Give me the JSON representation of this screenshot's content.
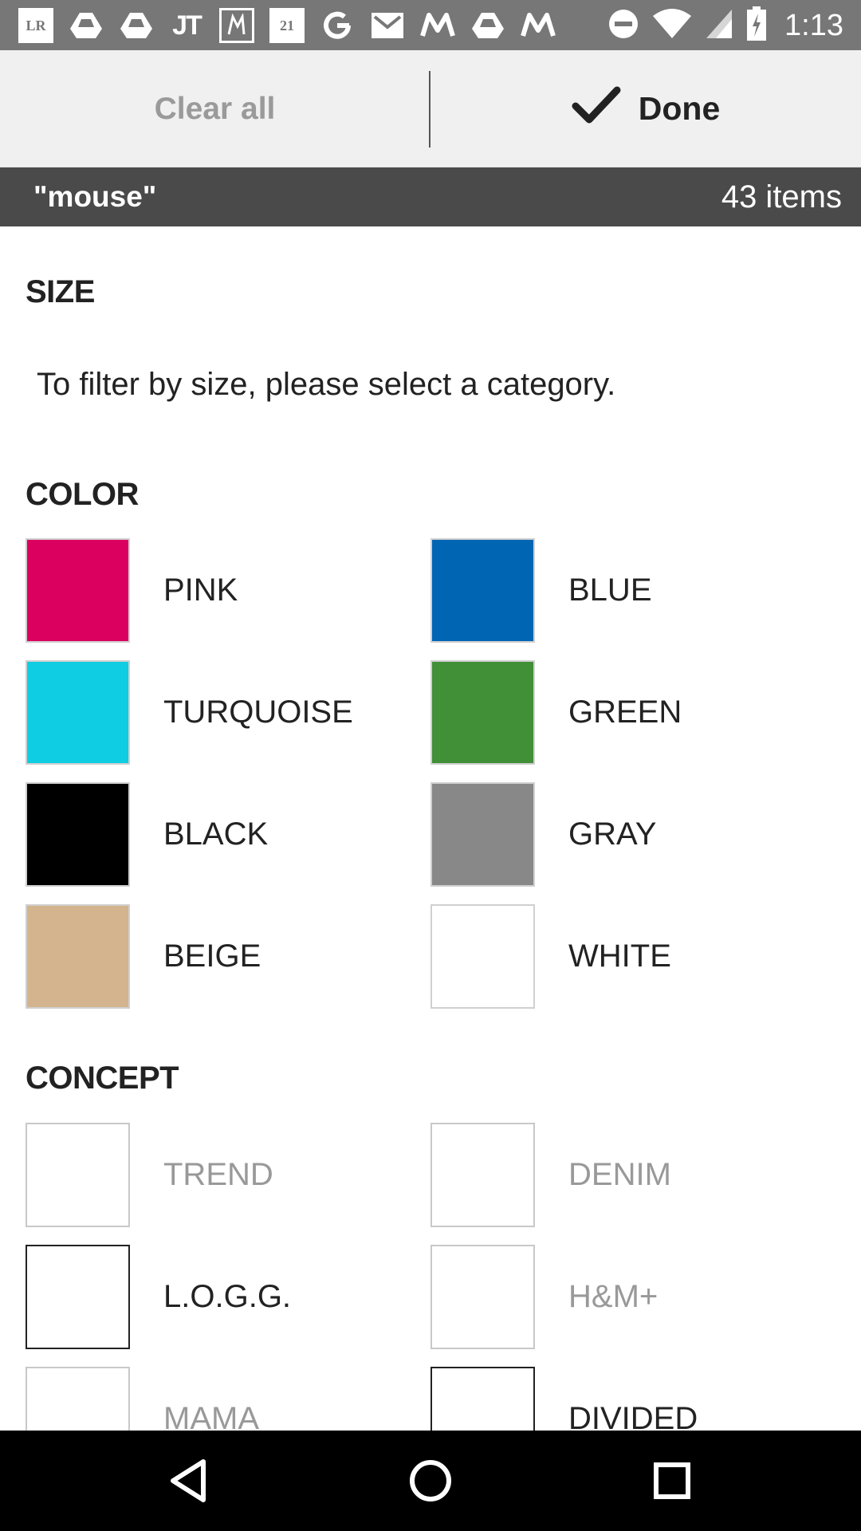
{
  "status_bar": {
    "time": "1:13",
    "left_icons": [
      "lr-icon",
      "drive-icon",
      "drive-icon",
      "jt-icon",
      "nt-icon",
      "forever21-icon",
      "google-icon",
      "gmail-icon",
      "m-icon",
      "drive-icon",
      "m-icon"
    ],
    "lr_text": "LR",
    "jt_text": "JT",
    "f21_text": "21",
    "right_icons": [
      "do-not-disturb-icon",
      "wifi-icon",
      "signal-icon",
      "battery-icon"
    ]
  },
  "action_bar": {
    "clear_label": "Clear all",
    "done_label": "Done"
  },
  "summary": {
    "query": "\"mouse\"",
    "count": "43 items"
  },
  "size": {
    "title": "SIZE",
    "note": "To filter by size, please select a category."
  },
  "color": {
    "title": "COLOR",
    "items": [
      {
        "label": "PINK",
        "hex": "#db005f"
      },
      {
        "label": "BLUE",
        "hex": "#0065b3"
      },
      {
        "label": "TURQUOISE",
        "hex": "#0fcde2"
      },
      {
        "label": "GREEN",
        "hex": "#418f37"
      },
      {
        "label": "BLACK",
        "hex": "#000000"
      },
      {
        "label": "GRAY",
        "hex": "#888888"
      },
      {
        "label": "BEIGE",
        "hex": "#d3b48e"
      },
      {
        "label": "WHITE",
        "hex": "#ffffff"
      }
    ]
  },
  "concept": {
    "title": "CONCEPT",
    "items": [
      {
        "label": "TREND",
        "enabled": false
      },
      {
        "label": "DENIM",
        "enabled": false
      },
      {
        "label": "L.O.G.G.",
        "enabled": true
      },
      {
        "label": "H&M+",
        "enabled": false
      },
      {
        "label": "MAMA",
        "enabled": false
      },
      {
        "label": "DIVIDED",
        "enabled": true
      }
    ]
  }
}
